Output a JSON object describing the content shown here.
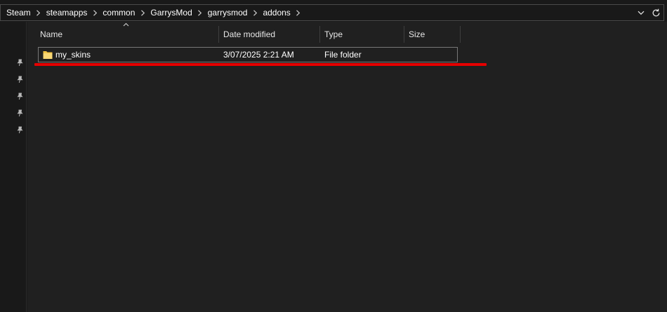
{
  "breadcrumb": {
    "items": [
      "Steam",
      "steamapps",
      "common",
      "GarrysMod",
      "garrysmod",
      "addons"
    ]
  },
  "icons": {
    "separator": "chevron-right-icon",
    "address_dropdown": "chevron-down-icon",
    "refresh": "refresh-icon",
    "pin": "pin-icon",
    "folder": "folder-icon",
    "sort": "sort-ascending-icon"
  },
  "columns": {
    "name": "Name",
    "date_modified": "Date modified",
    "type": "Type",
    "size": "Size"
  },
  "files": [
    {
      "name": "my_skins",
      "date_modified": "3/07/2025 2:21 AM",
      "type": "File folder",
      "size": ""
    }
  ],
  "colors": {
    "background": "#202020",
    "nav_background": "#191919",
    "highlight_line": "#e60000",
    "folder": "#f3c545"
  }
}
